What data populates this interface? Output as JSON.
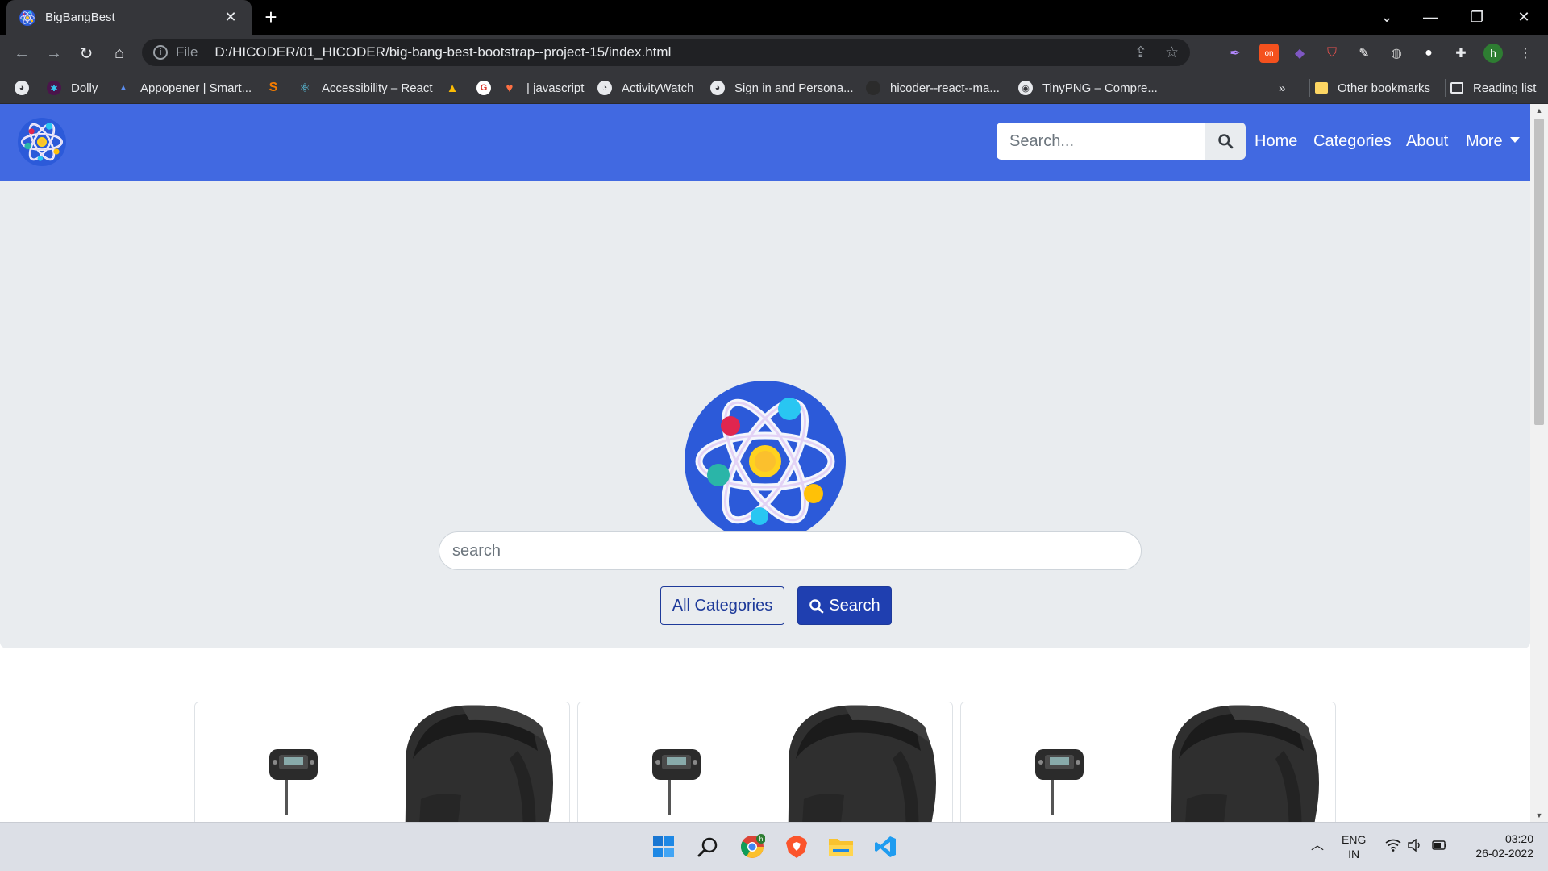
{
  "browser": {
    "tab": {
      "title": "BigBangBest"
    },
    "omnibox": {
      "scheme": "File",
      "url": "D:/HICODER/01_HICODER/big-bang-best-bootstrap--project-15/index.html"
    },
    "profile_initial": "h",
    "bookmarks": [
      {
        "label": "Dolly",
        "icon": "slack-icon"
      },
      {
        "label": "Appopener | Smart...",
        "icon": "appopener-icon"
      },
      {
        "label": "",
        "icon": "s-icon"
      },
      {
        "label": "Accessibility – React",
        "icon": "react-icon"
      },
      {
        "label": "",
        "icon": "drive-icon"
      },
      {
        "label": "",
        "icon": "notion-icon"
      },
      {
        "label": "| javascript",
        "icon": "heart-icon"
      },
      {
        "label": "ActivityWatch",
        "icon": "activitywatch-icon"
      },
      {
        "label": "Sign in and Persona...",
        "icon": "globe-icon"
      },
      {
        "label": "hicoder--react--ma...",
        "icon": "github-icon"
      },
      {
        "label": "TinyPNG – Compre...",
        "icon": "tinypng-icon"
      }
    ],
    "bookmarks_overflow": "»",
    "other_bookmarks": "Other bookmarks",
    "reading_list": "Reading list"
  },
  "site": {
    "nav": {
      "search_placeholder": "Search...",
      "links": [
        "Home",
        "Categories",
        "About",
        "More"
      ]
    },
    "hero": {
      "search_placeholder": "search",
      "all_categories": "All Categories",
      "search_button": "Search"
    },
    "cards": 3
  },
  "taskbar": {
    "lang_top": "ENG",
    "lang_bottom": "IN",
    "time": "03:20",
    "date": "26-02-2022",
    "apps": [
      "windows-start-icon",
      "search-icon",
      "chrome-icon",
      "brave-icon",
      "file-explorer-icon",
      "vscode-icon"
    ]
  },
  "colors": {
    "site_nav": "#4169e1",
    "hero_bg": "#e9ecef",
    "primary_button": "#1f3fb0"
  }
}
